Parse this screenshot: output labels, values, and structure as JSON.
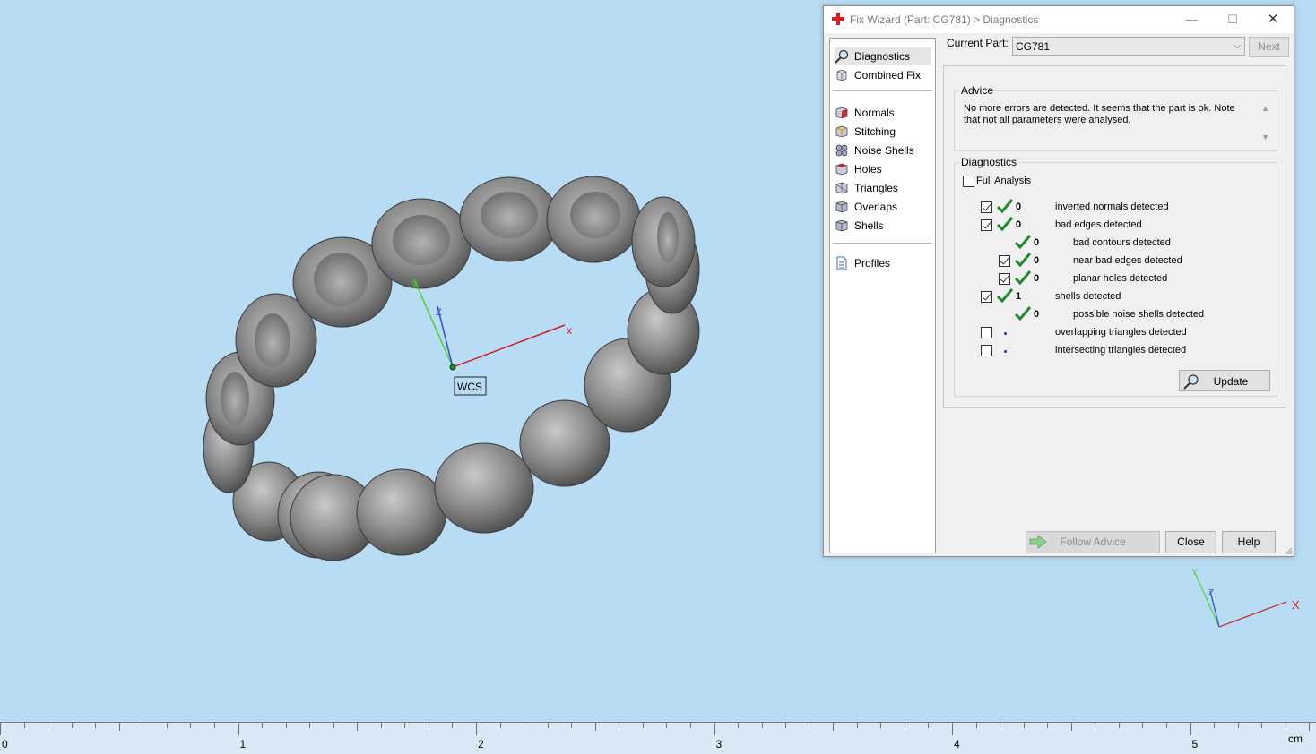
{
  "viewport": {
    "wcs_label": "WCS",
    "axis_x": "x",
    "axis_y": "Y",
    "axis_z": "Z",
    "mini_axis_x": "X",
    "mini_axis_y": "Y",
    "mini_axis_z": "Z"
  },
  "ruler": {
    "labels": [
      "0",
      "1",
      "2",
      "3",
      "4",
      "5"
    ],
    "unit": "cm"
  },
  "dialog": {
    "title": "Fix Wizard (Part: CG781) > Diagnostics",
    "minimize": "—",
    "maximize": "☐",
    "close": "✕",
    "nav": {
      "diagnostics": "Diagnostics",
      "combined_fix": "Combined Fix",
      "normals": "Normals",
      "stitching": "Stitching",
      "noise_shells": "Noise Shells",
      "holes": "Holes",
      "triangles": "Triangles",
      "overlaps": "Overlaps",
      "shells": "Shells",
      "profiles": "Profiles"
    },
    "current_part_label": "Current Part:",
    "current_part_value": "CG781",
    "next_label": "Next",
    "advice": {
      "legend": "Advice",
      "text": "No more errors are detected. It seems that the part is ok. Note that not all parameters were analysed."
    },
    "diagnostics": {
      "legend": "Diagnostics",
      "full_analysis": "Full Analysis",
      "rows": [
        {
          "count": "0",
          "label": "inverted normals detected"
        },
        {
          "count": "0",
          "label": "bad edges detected"
        },
        {
          "count": "0",
          "label": "bad contours detected"
        },
        {
          "count": "0",
          "label": "near bad edges detected"
        },
        {
          "count": "0",
          "label": "planar holes detected"
        },
        {
          "count": "1",
          "label": "shells detected"
        },
        {
          "count": "0",
          "label": "possible noise shells detected"
        },
        {
          "count": "",
          "label": "overlapping triangles detected"
        },
        {
          "count": "",
          "label": "intersecting triangles detected"
        }
      ],
      "update_label": "Update"
    },
    "follow_advice_label": "Follow Advice",
    "close_label": "Close",
    "help_label": "Help"
  },
  "colors": {
    "background": "#b9dcf5",
    "check_green": "#1e8a2e",
    "axis_x": "#cc1f1f",
    "axis_y": "#4fd12b",
    "axis_z": "#2b4fd1"
  }
}
